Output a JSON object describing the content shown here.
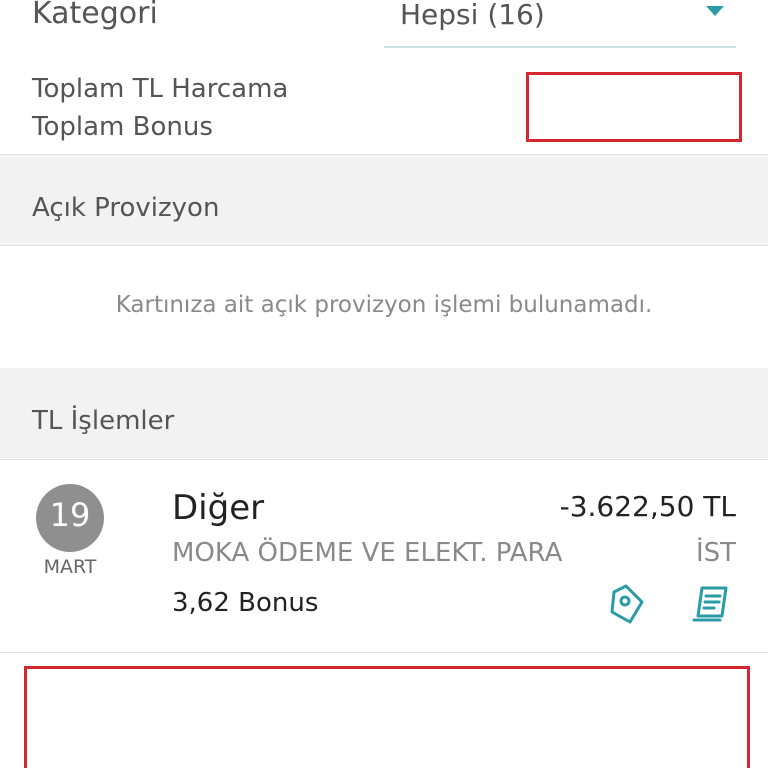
{
  "filter": {
    "label": "Kategori",
    "selected": "Hepsi (16)",
    "icon": "chevron-down-icon"
  },
  "totals": {
    "spend_label": "Toplam TL Harcama",
    "bonus_label": "Toplam Bonus"
  },
  "sections": {
    "open_provision": {
      "title": "Açık Provizyon",
      "empty_message": "Kartınıza ait açık provizyon işlemi bulunamadı."
    },
    "tl_transactions": {
      "title": "TL İşlemler"
    }
  },
  "transactions": [
    {
      "day": "19",
      "month": "MART",
      "category": "Diğer",
      "amount": "-3.622,50 TL",
      "merchant": "MOKA ÖDEME VE ELEKT. PARA",
      "city": "İST",
      "bonus": "3,62 Bonus",
      "icons": [
        "tag-icon",
        "receipt-icon"
      ]
    }
  ],
  "colors": {
    "accent": "#2a9ca7",
    "redaction_border": "#d6262e",
    "section_bg": "#f2f2f2",
    "date_circle": "#8f8f8f"
  }
}
